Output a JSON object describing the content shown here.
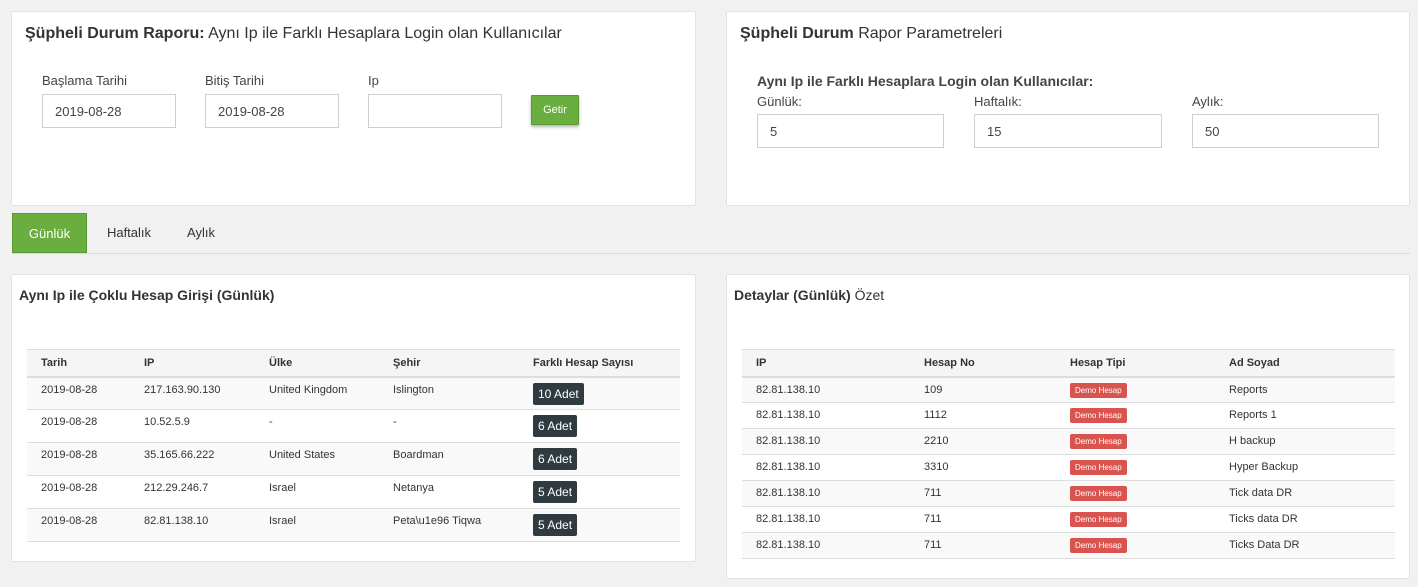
{
  "report_panel": {
    "title_bold": "Şüpheli Durum Raporu:",
    "title_rest": " Aynı Ip ile Farklı Hesaplara Login olan Kullanıcılar",
    "start_label": "Başlama Tarihi",
    "start_value": "2019-08-28",
    "end_label": "Bitiş Tarihi",
    "end_value": "2019-08-28",
    "ip_label": "Ip",
    "ip_value": "",
    "button_label": "Getir"
  },
  "params_panel": {
    "title_bold": "Şüpheli Durum",
    "title_rest": " Rapor Parametreleri",
    "subtitle": "Aynı Ip ile Farklı Hesaplara Login olan Kullanıcılar:",
    "daily_label": "Günlük:",
    "daily_value": "5",
    "weekly_label": "Haftalık:",
    "weekly_value": "15",
    "monthly_label": "Aylık:",
    "monthly_value": "50"
  },
  "tabs": [
    {
      "label": "Günlük",
      "active": true
    },
    {
      "label": "Haftalık",
      "active": false
    },
    {
      "label": "Aylık",
      "active": false
    }
  ],
  "multi_login": {
    "title": "Aynı Ip ile Çoklu Hesap Girişi (Günlük)",
    "headers": [
      "Tarih",
      "IP",
      "Ülke",
      "Şehir",
      "Farklı Hesap Sayısı"
    ],
    "rows": [
      [
        "2019-08-28",
        "217.163.90.130",
        "United Kingdom",
        "Islington",
        "10 Adet"
      ],
      [
        "2019-08-28",
        "10.52.5.9",
        "-",
        "-",
        "6 Adet"
      ],
      [
        "2019-08-28",
        "35.165.66.222",
        "United States",
        "Boardman",
        "6 Adet"
      ],
      [
        "2019-08-28",
        "212.29.246.7",
        "Israel",
        "Netanya",
        "5 Adet"
      ],
      [
        "2019-08-28",
        "82.81.138.10",
        "Israel",
        "Peta\\u1e96 Tiqwa",
        "5 Adet"
      ]
    ]
  },
  "details": {
    "title_bold": "Detaylar (Günlük)",
    "title_rest": " Özet",
    "headers": [
      "IP",
      "Hesap No",
      "Hesap Tipi",
      "Ad Soyad"
    ],
    "rows": [
      [
        "82.81.138.10",
        "109",
        "Demo Hesap",
        "Reports"
      ],
      [
        "82.81.138.10",
        "1112",
        "Demo Hesap",
        "Reports 1"
      ],
      [
        "82.81.138.10",
        "2210",
        "Demo Hesap",
        "H backup"
      ],
      [
        "82.81.138.10",
        "3310",
        "Demo Hesap",
        "Hyper Backup"
      ],
      [
        "82.81.138.10",
        "711",
        "Demo Hesap",
        "Tick data DR"
      ],
      [
        "82.81.138.10",
        "711",
        "Demo Hesap",
        "Ticks data DR"
      ],
      [
        "82.81.138.10",
        "711",
        "Demo Hesap",
        "Ticks Data DR"
      ]
    ]
  },
  "colors": {
    "accent": "#6aae3f",
    "badge_dark": "#2f3b40",
    "badge_red": "#d9534f"
  }
}
